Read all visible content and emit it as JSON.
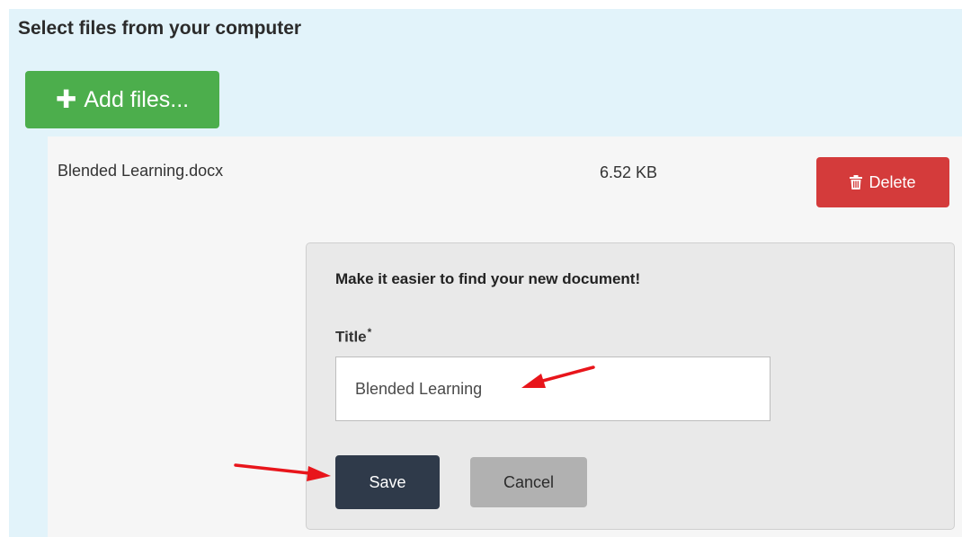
{
  "upload_panel": {
    "title": "Select files from your computer",
    "add_files_label": "Add files...",
    "add_files_color": "#4cae4c"
  },
  "file": {
    "name": "Blended Learning.docx",
    "size": "6.52 KB",
    "delete_label": "Delete",
    "delete_color": "#d43b3b"
  },
  "form": {
    "heading": "Make it easier to find your new document!",
    "title_label": "Title",
    "required_marker": "*",
    "title_value": "Blended Learning",
    "save_label": "Save",
    "cancel_label": "Cancel",
    "save_color": "#2f3a4a"
  },
  "icons": {
    "add": "plus-icon",
    "delete": "trash-icon"
  },
  "annotation_color": "#e8151b"
}
